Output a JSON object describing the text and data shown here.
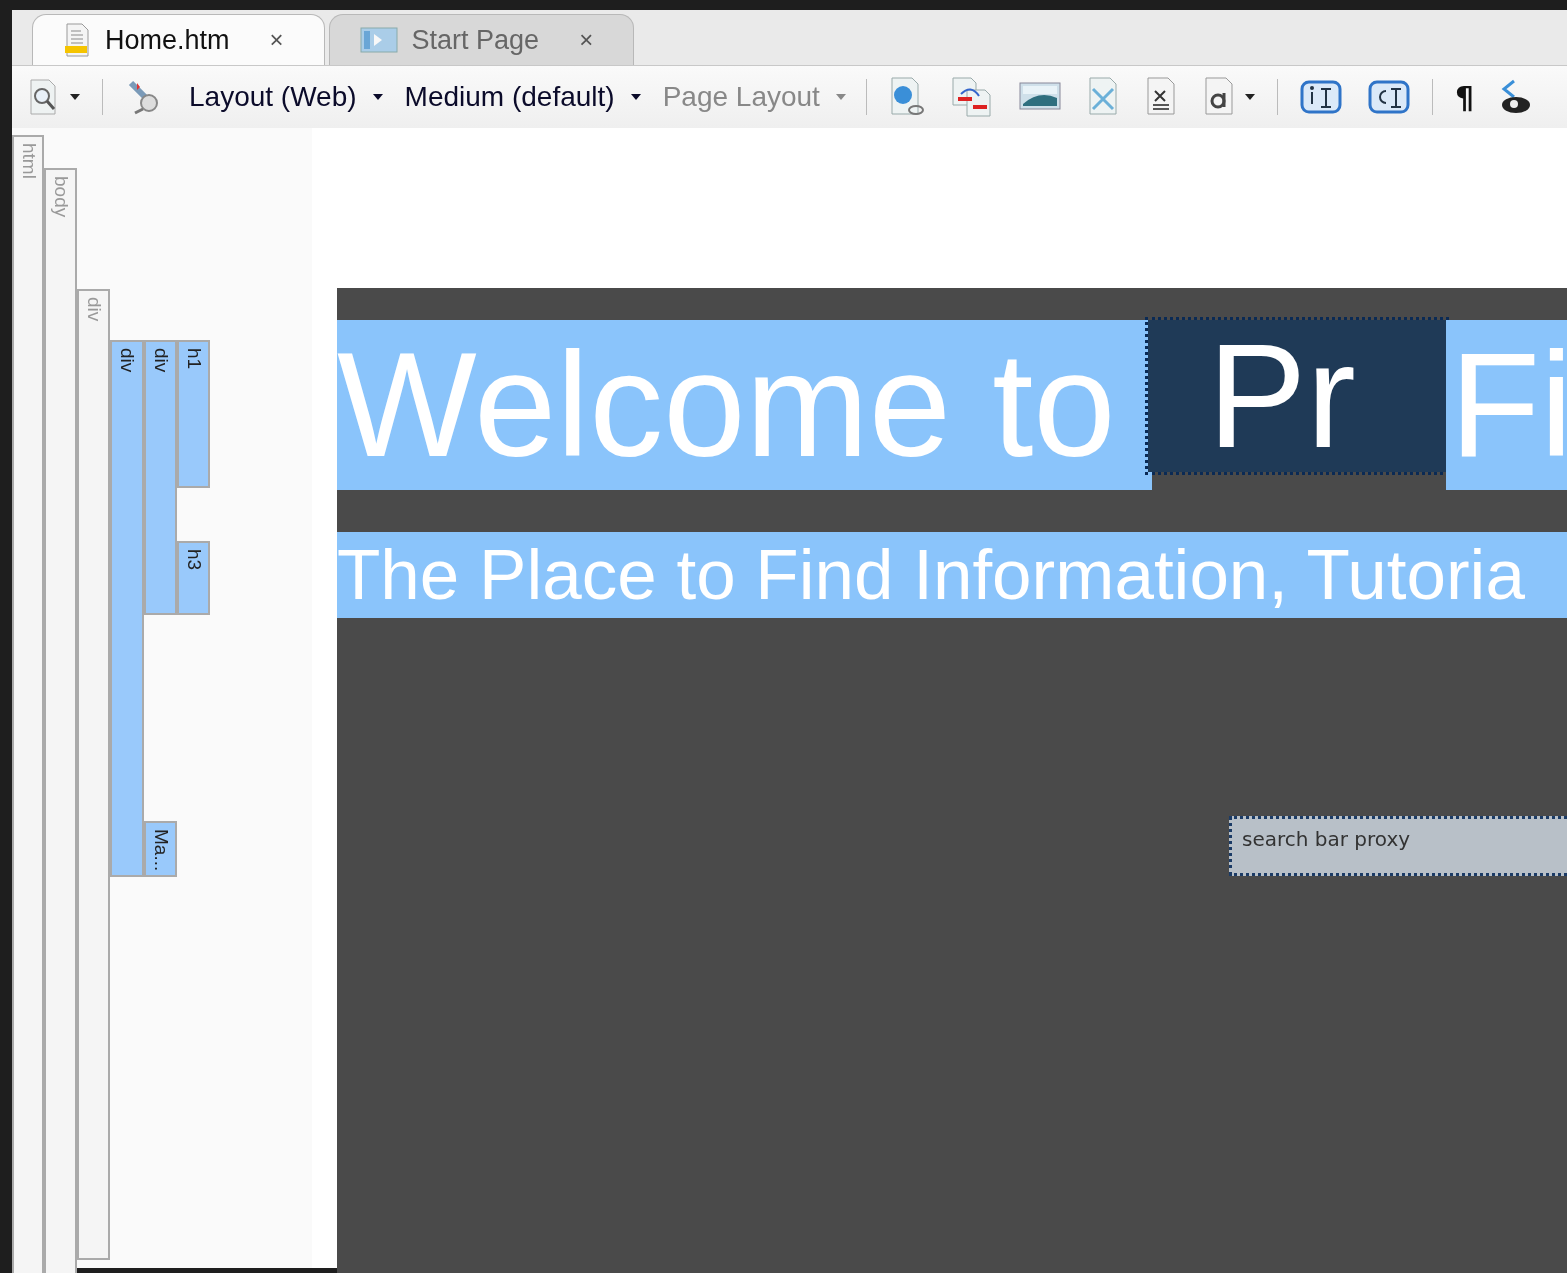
{
  "tabs": [
    {
      "label": "Home.htm",
      "close": "×",
      "selected": true,
      "kind": "document"
    },
    {
      "label": "Start Page",
      "close": "×",
      "selected": false,
      "kind": "start"
    }
  ],
  "toolbar": [
    {
      "kind": "preview",
      "dropdown": true
    },
    {
      "kind": "separator"
    },
    {
      "kind": "styles"
    },
    {
      "kind": "text",
      "label": "Layout (Web)",
      "dropdown": true,
      "disabled": false
    },
    {
      "kind": "text",
      "label": "Medium (default)",
      "dropdown": true,
      "disabled": false
    },
    {
      "kind": "text",
      "label": "Page Layout",
      "dropdown": true,
      "disabled": true
    },
    {
      "kind": "separator"
    },
    {
      "kind": "hyperlink"
    },
    {
      "kind": "compare"
    },
    {
      "kind": "image"
    },
    {
      "kind": "broken"
    },
    {
      "kind": "formula"
    },
    {
      "kind": "letter",
      "dropdown": true
    },
    {
      "kind": "separator"
    },
    {
      "kind": "id-badge"
    },
    {
      "kind": "class-badge"
    },
    {
      "kind": "separator"
    },
    {
      "kind": "pilcrow",
      "label": "¶"
    },
    {
      "kind": "eye"
    }
  ],
  "tag_tree": [
    {
      "tag": "html",
      "selected": false,
      "children": [
        {
          "tag": "body",
          "selected": false,
          "children": [
            {
              "tag": "div",
              "selected": false,
              "children": [
                {
                  "tag": "div",
                  "selected": true,
                  "children": [
                    {
                      "tag": "div",
                      "selected": true,
                      "children": [
                        {
                          "tag": "h1",
                          "selected": true
                        },
                        {
                          "tag": "h3",
                          "selected": true
                        }
                      ]
                    },
                    {
                      "tag": "Ma...",
                      "selected": true
                    }
                  ]
                }
              ]
            }
          ]
        }
      ]
    }
  ],
  "page": {
    "heading": [
      {
        "text": "Welcome to",
        "kind": "highlight"
      },
      {
        "text": "Pr",
        "kind": "dotted"
      },
      {
        "text": "Fi",
        "kind": "highlight"
      }
    ],
    "subheading": "The Place to Find Information, Tutoria",
    "search_proxy": "search bar proxy"
  }
}
